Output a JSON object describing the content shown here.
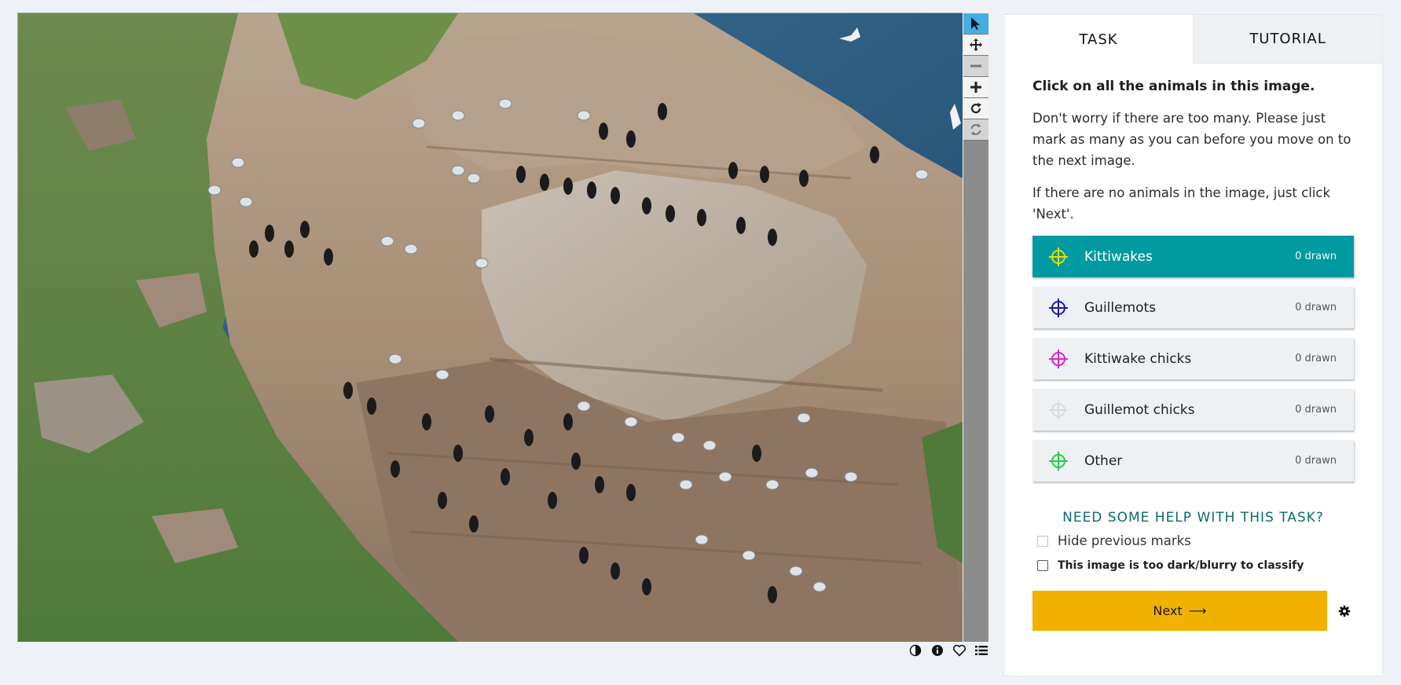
{
  "tabs": [
    {
      "label": "TASK"
    },
    {
      "label": "TUTORIAL"
    }
  ],
  "task": {
    "instruction": "Click on all the animals in this image.",
    "paragraphs": [
      "Don't worry if there are too many. Please just mark as many as you can before you move on to the next image.",
      "If there are no animals in the image, just click 'Next'."
    ],
    "choices": [
      {
        "label": "Kittiwakes",
        "count": "0 drawn",
        "color": "#e0e000"
      },
      {
        "label": "Guillemots",
        "count": "0 drawn",
        "color": "#1a1aa8"
      },
      {
        "label": "Kittiwake chicks",
        "count": "0 drawn",
        "color": "#e020d0"
      },
      {
        "label": "Guillemot chicks",
        "count": "0 drawn",
        "color": "#dadada"
      },
      {
        "label": "Other",
        "count": "0 drawn",
        "color": "#20d040"
      }
    ],
    "help_label": "NEED SOME HELP WITH THIS TASK?",
    "hide_marks_label": "Hide previous marks",
    "dark_blurry_label": "This image is too dark/blurry to classify",
    "next_label": "Next",
    "next_arrow": "⟶"
  },
  "toolbar": {
    "tools": [
      "pointer-icon",
      "move-icon",
      "zoom-out-icon",
      "zoom-in-icon",
      "rotate-icon",
      "reset-icon"
    ]
  },
  "meta": {
    "icons": [
      "contrast-icon",
      "info-icon",
      "favorite-icon",
      "collections-icon"
    ]
  },
  "colors": {
    "selected_choice": "#009aa0",
    "next_button": "#f0b100",
    "active_tool": "#44aee3",
    "help_text": "#0b6a6d"
  }
}
